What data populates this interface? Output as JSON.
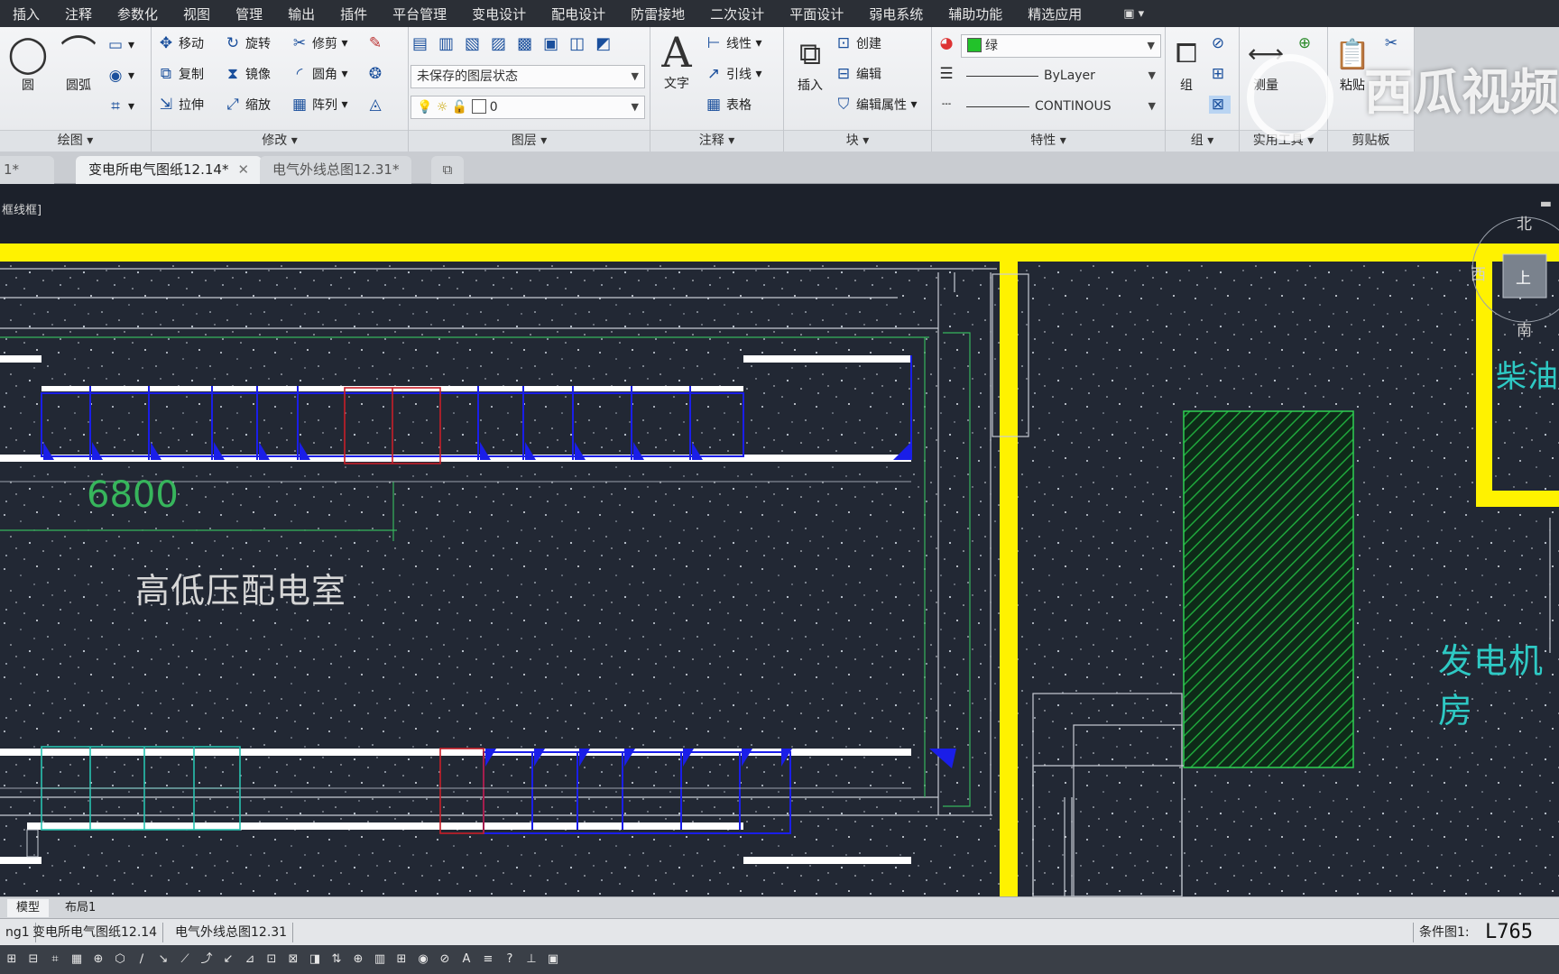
{
  "menu": [
    "插入",
    "注释",
    "参数化",
    "视图",
    "管理",
    "输出",
    "插件",
    "平台管理",
    "变电设计",
    "配电设计",
    "防雷接地",
    "二次设计",
    "平面设计",
    "弱电系统",
    "辅助功能",
    "精选应用"
  ],
  "menu_qat": "▣ ▾",
  "ribbon": {
    "draw": {
      "title": "绘图 ▾",
      "circle": "圆",
      "arc": "圆弧"
    },
    "modify": {
      "title": "修改 ▾",
      "move": "移动",
      "rotate": "旋转",
      "trim": "修剪",
      "copy": "复制",
      "mirror": "镜像",
      "fillet": "圆角",
      "stretch": "拉伸",
      "scale": "缩放",
      "array": "阵列"
    },
    "layers": {
      "title": "图层 ▾",
      "state": "未保存的图层状态",
      "current_layer": "0"
    },
    "annotation": {
      "title": "注释 ▾",
      "text": "文字",
      "linear": "线性",
      "leader": "引线",
      "table": "表格"
    },
    "block": {
      "title": "块 ▾",
      "insert": "插入",
      "create": "创建",
      "edit": "编辑",
      "edit_attr": "编辑属性"
    },
    "properties": {
      "title": "特性 ▾",
      "color": "绿",
      "color_hex": "#22c22a",
      "lineweight": "ByLayer",
      "linetype": "CONTINOUS"
    },
    "group": {
      "title": "组 ▾",
      "group": "组"
    },
    "utilities": {
      "title": "实用工具 ▾",
      "measure": "测量"
    },
    "clipboard": {
      "title": "剪贴板",
      "paste": "粘贴"
    }
  },
  "file_tabs": [
    {
      "label": "1*",
      "active": false
    },
    {
      "label": "变电所电气图纸12.14*",
      "active": true
    },
    {
      "label": "电气外线总图12.31*",
      "active": false
    }
  ],
  "viewport": {
    "label": "框线框]",
    "dimension": "6800",
    "room_hv_lv": "高低压配电室",
    "room_generator": "发电机房",
    "room_oil": "柴油",
    "compass": {
      "north": "北",
      "west": "西",
      "south": "南",
      "top": "上"
    }
  },
  "layout_tabs": [
    "模型",
    "布局1"
  ],
  "doc_tabs": [
    "ng1",
    "变电所电气图纸12.14",
    "电气外线总图12.31"
  ],
  "status_right": "条件图1:",
  "coord_readout": "L765",
  "watermark": "西瓜视频",
  "colors": {
    "wall": "#fff200",
    "hatch": "#1f9e3a",
    "dim": "#37b55c",
    "room_text": "#d6d6d6",
    "room_text2": "#2ec9c4",
    "blue": "#1a1ee8",
    "red": "#c81e28",
    "cyan": "#27c2b0"
  }
}
